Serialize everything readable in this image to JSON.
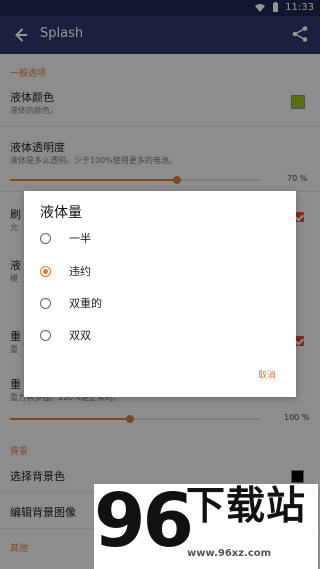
{
  "status": {
    "time": "11:33"
  },
  "app": {
    "title": "Splash"
  },
  "background": {
    "sections": {
      "general": "一般选项",
      "background": "背景",
      "other": "其他"
    },
    "liquid_color": {
      "title": "液体颜色",
      "subtitle": "液体的颜色。",
      "color": "#9bbd1f"
    },
    "liquid_transparency": {
      "title": "液体透明度",
      "subtitle": "液体是多么透明。少于100%使用更多的电池。",
      "value_text": "70 %",
      "value": 70
    },
    "partial_title": "刷",
    "partial_sub": "允",
    "partial_title_2": "液",
    "partial_sub_2": "模",
    "partial_title_3": "重",
    "partial_sub_3": "重",
    "partial_title_4": "重",
    "gravity_sub": "重力有多强。100%是正常的。",
    "gravity_value_text": "100 %",
    "gravity_value": 100,
    "choose_bg_color": "选择背景色",
    "edit_bg_image": "编辑背景图像"
  },
  "dialog": {
    "title": "液体量",
    "options": [
      "一半",
      "违约",
      "双重的",
      "双双"
    ],
    "selected_index": 1,
    "cancel_label": "取消"
  },
  "watermark": {
    "number": "96",
    "text": "下载站",
    "url": "www.96xz.com"
  }
}
